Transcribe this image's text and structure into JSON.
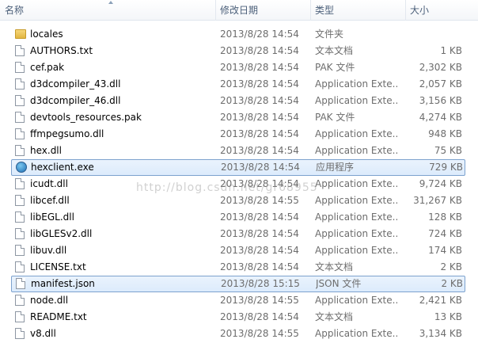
{
  "columns": {
    "name": "名称",
    "date": "修改日期",
    "type": "类型",
    "size": "大小"
  },
  "watermark": "http://blog.csdn.net/gr68955",
  "files": [
    {
      "name": "locales",
      "date": "2013/8/28 14:54",
      "type": "文件夹",
      "size": "",
      "icon": "folder-icon"
    },
    {
      "name": "AUTHORS.txt",
      "date": "2013/8/28 14:54",
      "type": "文本文档",
      "size": "1 KB",
      "icon": "text-file-icon"
    },
    {
      "name": "cef.pak",
      "date": "2013/8/28 14:54",
      "type": "PAK 文件",
      "size": "2,302 KB",
      "icon": "file-icon"
    },
    {
      "name": "d3dcompiler_43.dll",
      "date": "2013/8/28 14:54",
      "type": "Application Exte...",
      "size": "2,057 KB",
      "icon": "dll-file-icon"
    },
    {
      "name": "d3dcompiler_46.dll",
      "date": "2013/8/28 14:54",
      "type": "Application Exte...",
      "size": "3,156 KB",
      "icon": "dll-file-icon"
    },
    {
      "name": "devtools_resources.pak",
      "date": "2013/8/28 14:54",
      "type": "PAK 文件",
      "size": "4,274 KB",
      "icon": "file-icon"
    },
    {
      "name": "ffmpegsumo.dll",
      "date": "2013/8/28 14:54",
      "type": "Application Exte...",
      "size": "948 KB",
      "icon": "dll-file-icon"
    },
    {
      "name": "hex.dll",
      "date": "2013/8/28 14:54",
      "type": "Application Exte...",
      "size": "75 KB",
      "icon": "dll-file-icon"
    },
    {
      "name": "hexclient.exe",
      "date": "2013/8/28 14:54",
      "type": "应用程序",
      "size": "729 KB",
      "icon": "exe-icon",
      "selected": true
    },
    {
      "name": "icudt.dll",
      "date": "2013/8/28 14:54",
      "type": "Application Exte...",
      "size": "9,724 KB",
      "icon": "dll-file-icon"
    },
    {
      "name": "libcef.dll",
      "date": "2013/8/28 14:55",
      "type": "Application Exte...",
      "size": "31,267 KB",
      "icon": "dll-file-icon"
    },
    {
      "name": "libEGL.dll",
      "date": "2013/8/28 14:54",
      "type": "Application Exte...",
      "size": "128 KB",
      "icon": "dll-file-icon"
    },
    {
      "name": "libGLESv2.dll",
      "date": "2013/8/28 14:54",
      "type": "Application Exte...",
      "size": "724 KB",
      "icon": "dll-file-icon"
    },
    {
      "name": "libuv.dll",
      "date": "2013/8/28 14:54",
      "type": "Application Exte...",
      "size": "174 KB",
      "icon": "dll-file-icon"
    },
    {
      "name": "LICENSE.txt",
      "date": "2013/8/28 14:54",
      "type": "文本文档",
      "size": "2 KB",
      "icon": "text-file-icon"
    },
    {
      "name": "manifest.json",
      "date": "2013/8/28 15:15",
      "type": "JSON 文件",
      "size": "2 KB",
      "icon": "file-icon",
      "selected": true
    },
    {
      "name": "node.dll",
      "date": "2013/8/28 14:55",
      "type": "Application Exte...",
      "size": "2,421 KB",
      "icon": "dll-file-icon"
    },
    {
      "name": "README.txt",
      "date": "2013/8/28 14:54",
      "type": "文本文档",
      "size": "13 KB",
      "icon": "text-file-icon"
    },
    {
      "name": "v8.dll",
      "date": "2013/8/28 14:55",
      "type": "Application Exte...",
      "size": "3,134 KB",
      "icon": "dll-file-icon"
    }
  ]
}
